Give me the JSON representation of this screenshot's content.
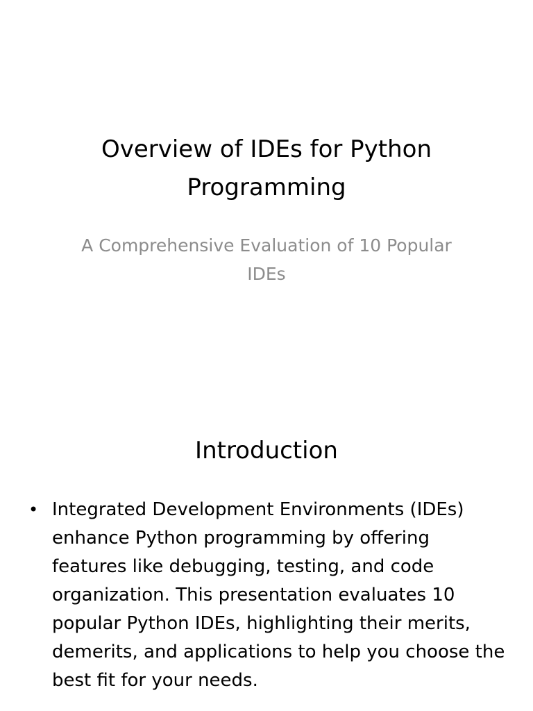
{
  "slides": [
    {
      "title": "Overview of IDEs for Python Programming",
      "subtitle": "A Comprehensive Evaluation of 10 Popular IDEs"
    },
    {
      "title": "Introduction",
      "bullets": [
        {
          "text": "Integrated Development Environments (IDEs) enhance Python programming by offering features like debugging, testing, and code organization. This presentation evaluates 10 popular Python IDEs, highlighting their merits, demerits, and applications to help you choose the best fit for your needs."
        }
      ]
    }
  ]
}
